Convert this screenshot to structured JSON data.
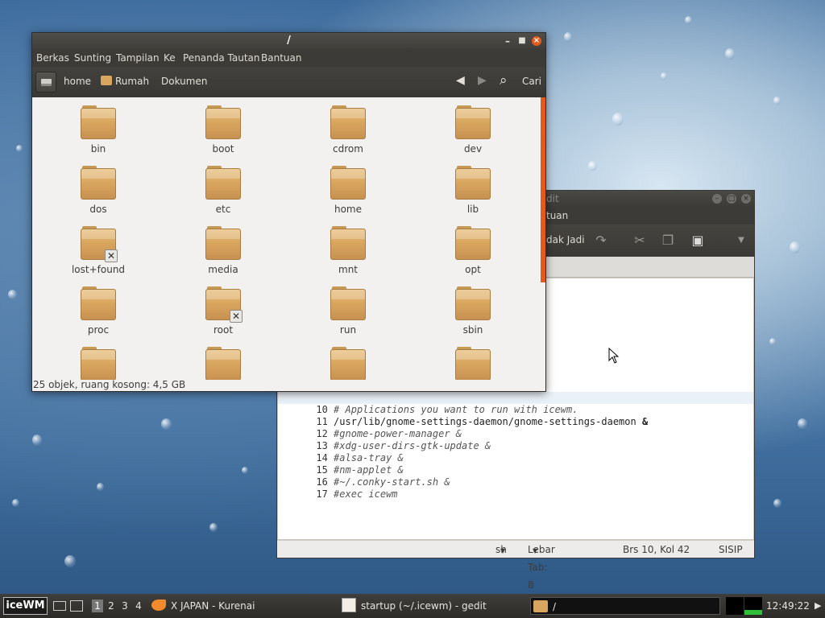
{
  "desktop": {
    "background": "rain-drops-blue"
  },
  "nautilus": {
    "title": "/",
    "menu": [
      "Berkas",
      "Sunting",
      "Tampilan",
      "Ke",
      "Penanda Tautan",
      "Bantuan"
    ],
    "breadcrumbs": [
      "home",
      "Rumah",
      "Dokumen"
    ],
    "search_label": "Cari",
    "items": [
      {
        "name": "bin",
        "locked": false
      },
      {
        "name": "boot",
        "locked": false
      },
      {
        "name": "cdrom",
        "locked": false
      },
      {
        "name": "dev",
        "locked": false
      },
      {
        "name": "dos",
        "locked": false
      },
      {
        "name": "etc",
        "locked": false
      },
      {
        "name": "home",
        "locked": false
      },
      {
        "name": "lib",
        "locked": false
      },
      {
        "name": "lost+found",
        "locked": true
      },
      {
        "name": "media",
        "locked": false
      },
      {
        "name": "mnt",
        "locked": false
      },
      {
        "name": "opt",
        "locked": false
      },
      {
        "name": "proc",
        "locked": false
      },
      {
        "name": "root",
        "locked": true
      },
      {
        "name": "run",
        "locked": false
      },
      {
        "name": "sbin",
        "locked": false
      },
      {
        "name": "",
        "locked": false
      },
      {
        "name": "",
        "locked": false
      },
      {
        "name": "",
        "locked": false
      },
      {
        "name": "",
        "locked": false
      }
    ],
    "status": "25 objek, ruang kosong: 4,5 GB",
    "accent": "#e25a1c"
  },
  "gedit": {
    "title_partial": "dit",
    "menu_partial": "tuan",
    "toolbar_partial": "dak Jadi",
    "lines": [
      {
        "num": "10",
        "code": "# Applications you want to run with icewm.",
        "type": "comment"
      },
      {
        "num": "11",
        "code": "/usr/lib/gnome-settings-daemon/gnome-settings-daemon",
        "suffix": " &",
        "type": "cmd"
      },
      {
        "num": "12",
        "code": "#gnome-power-manager &",
        "type": "comment"
      },
      {
        "num": "13",
        "code": "#xdg-user-dirs-gtk-update &",
        "type": "comment"
      },
      {
        "num": "14",
        "code": "#alsa-tray &",
        "type": "comment"
      },
      {
        "num": "15",
        "code": "#nm-applet &",
        "type": "comment"
      },
      {
        "num": "16",
        "code": "#~/.conky-start.sh &",
        "type": "comment"
      },
      {
        "num": "17",
        "code": "#exec icewm",
        "type": "comment"
      }
    ],
    "status": {
      "language": "sh",
      "tab_width": "Lebar Tab:  8",
      "position": "Brs 10, Kol 42",
      "mode": "SISIP"
    }
  },
  "taskbar": {
    "start_label": "iceWM",
    "workspaces": [
      "1",
      "2",
      "3",
      "4"
    ],
    "active_workspace": "1",
    "tasks": [
      {
        "label": "X JAPAN - Kurenai",
        "icon": "mango-icon"
      },
      {
        "label": "startup (~/.icewm) - gedit",
        "icon": "text-editor-icon"
      },
      {
        "label": "/",
        "icon": "folder-icon"
      }
    ],
    "clock": "12:49:22"
  }
}
